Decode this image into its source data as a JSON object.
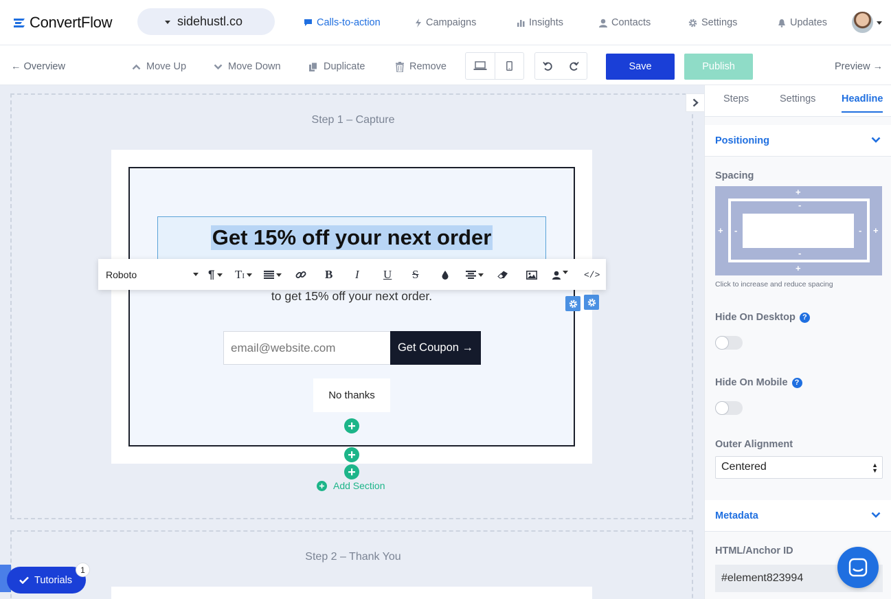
{
  "brand": {
    "logo_text": "ConvertFlow",
    "accent": "#1f6fe0",
    "save_color": "#1a3fd7",
    "publish_color": "#8fdcc7",
    "add_color": "#1db589"
  },
  "site": {
    "name": "sidehustl.co"
  },
  "nav": {
    "calls_to_action": "Calls-to-action",
    "campaigns": "Campaigns",
    "insights": "Insights",
    "contacts": "Contacts",
    "settings": "Settings",
    "updates": "Updates"
  },
  "toolbar": {
    "overview": "← Overview",
    "move_up": "Move Up",
    "move_down": "Move Down",
    "duplicate": "Duplicate",
    "remove": "Remove",
    "save": "Save",
    "publish": "Publish",
    "preview": "Preview →"
  },
  "canvas": {
    "step1_title": "Step 1 – Capture",
    "step2_title": "Step 2 – Thank You",
    "headline": "Get 15% off your next order",
    "subtext": "to get 15% off your next order.",
    "email_placeholder": "email@website.com",
    "coupon_button": "Get Coupon →",
    "no_thanks": "No thanks",
    "add_section": "Add Section"
  },
  "rte": {
    "font": "Roboto",
    "bold": "B",
    "italic": "I",
    "underline": "U",
    "strike": "S",
    "code": "</>"
  },
  "tutorials": {
    "label": "Tutorials",
    "badge": "1"
  },
  "panel": {
    "tabs": [
      "Steps",
      "Settings",
      "Headline"
    ],
    "active_tab": "Headline",
    "positioning": "Positioning",
    "spacing_label": "Spacing",
    "spacing_hint": "Click to increase and reduce spacing",
    "hide_desktop": "Hide On Desktop",
    "hide_mobile": "Hide On Mobile",
    "hide_desktop_on": false,
    "hide_mobile_on": false,
    "outer_alignment_label": "Outer Alignment",
    "outer_alignment_value": "Centered",
    "metadata": "Metadata",
    "anchor_label": "HTML/Anchor ID",
    "anchor_value": "#element823994"
  }
}
